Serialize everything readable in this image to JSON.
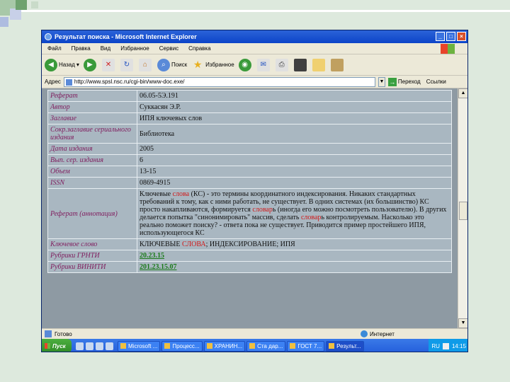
{
  "window": {
    "title": "Результат поиска - Microsoft Internet Explorer",
    "buttons": [
      "_",
      "□",
      "×"
    ]
  },
  "menu": [
    "Файл",
    "Правка",
    "Вид",
    "Избранное",
    "Сервис",
    "Справка"
  ],
  "toolbar": {
    "back": "Назад",
    "search": "Поиск",
    "favorites": "Избранное"
  },
  "address": {
    "label": "Адрес",
    "url": "http://www.spsl.nsc.ru/cgi-bin/www-doc.exe/",
    "go": "Переход",
    "links": "Ссылки"
  },
  "record": {
    "rows": [
      {
        "label": "Реферат",
        "value": "06.05-5Э.191"
      },
      {
        "label": "Автор",
        "value": "Суккасян Э.Р."
      },
      {
        "label": "Заглавие",
        "value": "ИПЯ ключевых слов"
      },
      {
        "label": "Сокр.заглавие сериального издания",
        "value": "Библиотека"
      },
      {
        "label": "Дата издания",
        "value": "2005"
      },
      {
        "label": "Вып. сер. издания",
        "value": "6"
      },
      {
        "label": "Объем",
        "value": "13-15"
      },
      {
        "label": "ISSN",
        "value": "0869-4915"
      }
    ],
    "abstract_label": "Реферат (аннотация)",
    "abstract_parts": [
      "Ключевые ",
      "слова",
      " (КС) - это термины координатного индексирования. Никаких стандартных требований к тому, как с ними работать, не существует. В одних системах (их большинство) КС просто накапливаются, формируется ",
      "словар",
      "ь (иногда его можно посмотреть пользователю). В других делается попытка \"синонимировать\" массив, сделать ",
      "словар",
      "ь контролируемым. Насколько это реально поможет поиску? - ответа пока не существует. Приводится пример простейшего ИПЯ, использующегося КС"
    ],
    "keyword_label": "Ключевое слово",
    "keyword_parts": [
      "КЛЮЧЕВЫЕ ",
      "СЛОВА",
      "; ИНДЕКСИРОВАНИЕ; ИПЯ"
    ],
    "rubric1_label": "Рубрики ГРНТИ",
    "rubric1_value": "20.23.15",
    "rubric2_label": "Рубрики ВИНИТИ",
    "rubric2_value": "201.23.15.07"
  },
  "status": {
    "left": "Готово",
    "zone": "Интернет"
  },
  "taskbar": {
    "start": "Пуск",
    "tasks": [
      "Microsoft ...",
      "Процесс...",
      "ХРАНИН...",
      "Ста дар...",
      "ГОСТ 7...",
      "Результ..."
    ],
    "lang": "RU",
    "time": "14:15"
  },
  "colors": {
    "label_text": "#802060",
    "highlight": "#d01818",
    "rubric_link": "#1a7a1a",
    "table_cell": "#a9b7c1",
    "page_bg": "#8e9aa3"
  }
}
